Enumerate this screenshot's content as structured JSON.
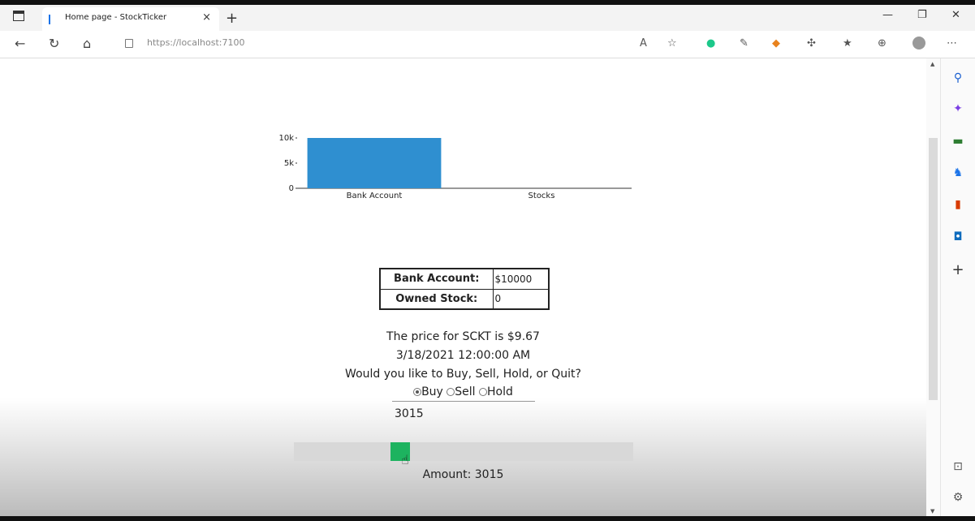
{
  "browser": {
    "tab_title": "Home page - StockTicker",
    "new_tab_symbol": "+",
    "close_tab_symbol": "×",
    "url": "https://localhost:7100",
    "window_controls": {
      "minimize": "—",
      "restore": "❐",
      "close": "✕"
    }
  },
  "chart_data": {
    "type": "bar",
    "categories": [
      "Bank Account",
      "Stocks"
    ],
    "values": [
      10000,
      0
    ],
    "y_ticks": [
      "0",
      "5k",
      "10k"
    ],
    "ylim": [
      0,
      10000
    ],
    "bar_color": "#2f8fd0"
  },
  "account_table": {
    "bank_label": "Bank Account:",
    "bank_value": "$10000",
    "stock_label": "Owned Stock:",
    "stock_value": "0"
  },
  "prompt": {
    "price_line": "The price for SCKT is $9.67",
    "date_line": "3/18/2021 12:00:00 AM",
    "question": "Would you like to Buy, Sell, Hold, or Quit?"
  },
  "options": {
    "buy": "Buy",
    "sell": "Sell",
    "hold": "Hold",
    "selected": "buy"
  },
  "amount_input": {
    "value": "3015"
  },
  "slider": {
    "value_fraction": 0.3015,
    "color": "#1db35f"
  },
  "amount_label": "Amount: 3015"
}
